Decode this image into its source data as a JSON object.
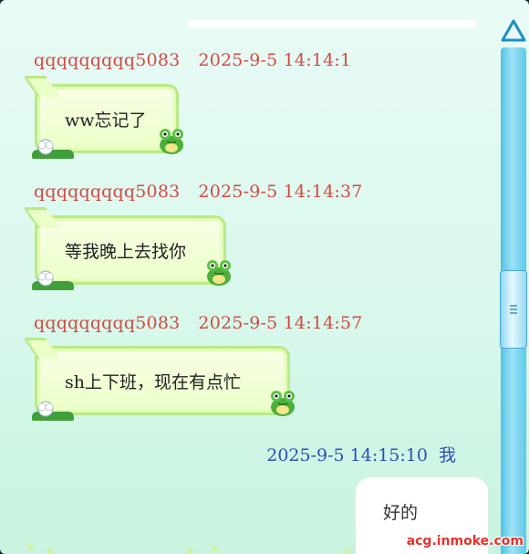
{
  "messages": [
    {
      "sender": "qqqqqqqqq5083",
      "time": "2025-9-5  14:14:1",
      "text": "ww忘记了"
    },
    {
      "sender": "qqqqqqqqq5083",
      "time": "2025-9-5  14:14:37",
      "text": "等我晚上去找你"
    },
    {
      "sender": "qqqqqqqqq5083",
      "time": "2025-9-5  14:14:57",
      "text": "sh上下班，现在有点忙"
    }
  ],
  "self_message": {
    "time": "2025-9-5  14:15:10",
    "sender": "我",
    "text": "好的"
  },
  "watermark": "acg.inmoke.com",
  "colors": {
    "other_header": "#d24a43",
    "self_header": "#2f4fb5",
    "bubble_border": "#b9ea86",
    "scrollbar": "#4fc2e6"
  },
  "icons": [
    "frog-icon",
    "white-flower-icon",
    "scroll-up-arrow-icon",
    "scroll-grip-icon",
    "star-icon"
  ]
}
